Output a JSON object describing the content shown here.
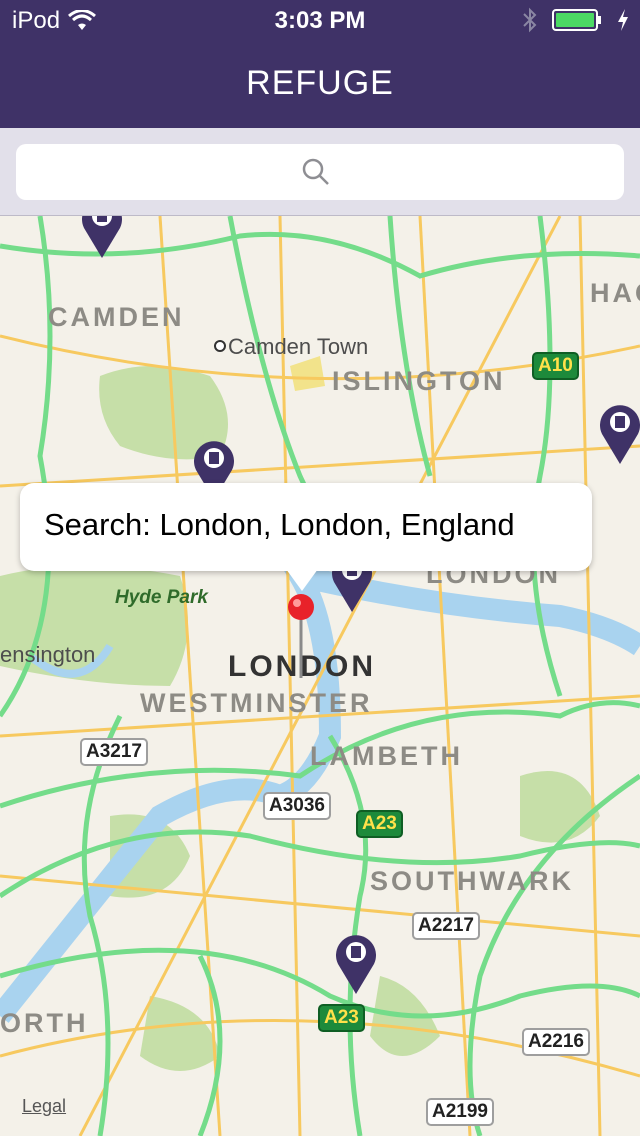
{
  "status_bar": {
    "carrier": "iPod",
    "time": "3:03 PM"
  },
  "nav": {
    "title": "REFUGE"
  },
  "search": {
    "placeholder": ""
  },
  "map": {
    "area_labels": [
      "CAMDEN",
      "ISLINGTON",
      "WESTMINSTER",
      "LAMBETH",
      "SOUTHWARK",
      "LONDON",
      "HAC",
      "ORTH"
    ],
    "place_labels": {
      "camden_town": "Camden Town",
      "kensington": "ensington"
    },
    "park_labels": {
      "hyde_park": "Hyde Park"
    },
    "city_label": "LONDON",
    "road_shields": [
      "A10",
      "A3217",
      "A3036",
      "A23",
      "A2217",
      "A23",
      "A2216",
      "A2199"
    ],
    "callout": "Search: London, London, England",
    "legal": "Legal"
  }
}
